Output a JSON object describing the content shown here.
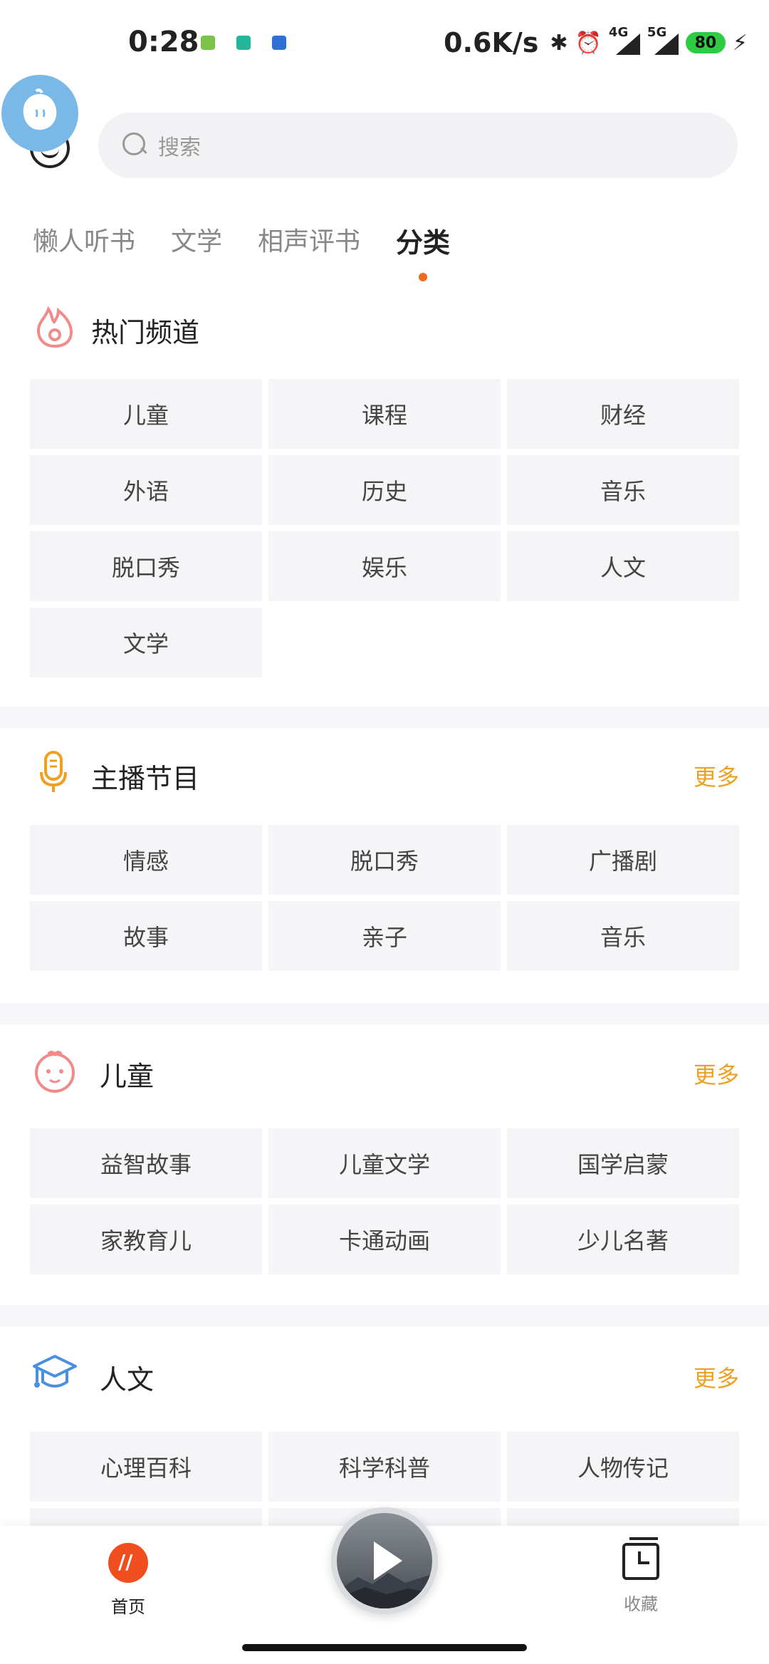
{
  "status_bar": {
    "time": "0:28",
    "net_speed": "0.6K/s",
    "sig1_label": "4G",
    "sig2_label": "5G",
    "battery": "80"
  },
  "search": {
    "placeholder": "搜索"
  },
  "tabs": [
    {
      "label": "懒人听书",
      "active": false
    },
    {
      "label": "文学",
      "active": false
    },
    {
      "label": "相声评书",
      "active": false
    },
    {
      "label": "分类",
      "active": true
    }
  ],
  "sections": {
    "hot": {
      "title": "热门频道",
      "icon": "flame-icon",
      "items": [
        "儿童",
        "课程",
        "财经",
        "外语",
        "历史",
        "音乐",
        "脱口秀",
        "娱乐",
        "人文",
        "文学"
      ]
    },
    "anchor": {
      "title": "主播节目",
      "more": "更多",
      "icon": "microphone-icon",
      "items": [
        "情感",
        "脱口秀",
        "广播剧",
        "故事",
        "亲子",
        "音乐"
      ]
    },
    "kids": {
      "title": "儿童",
      "more": "更多",
      "icon": "baby-face-icon",
      "items": [
        "益智故事",
        "儿童文学",
        "国学启蒙",
        "家教育儿",
        "卡通动画",
        "少儿名著"
      ]
    },
    "humanities": {
      "title": "人文",
      "more": "更多",
      "icon": "graduation-cap-icon",
      "items": [
        "心理百科",
        "科学科普",
        "人物传记"
      ]
    }
  },
  "bottom_nav": {
    "home_label": "首页",
    "fav_label": "收藏"
  },
  "colors": {
    "accent_orange": "#f06a1e",
    "more_yellow": "#f0a020",
    "cell_bg": "#f5f5f7"
  }
}
